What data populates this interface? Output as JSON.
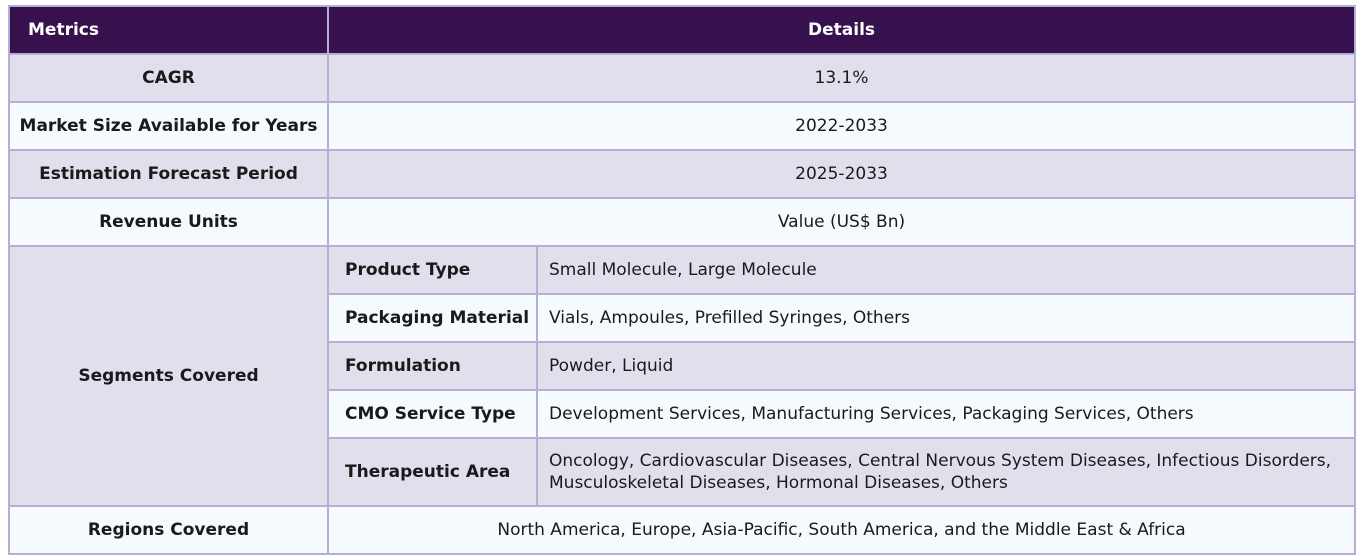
{
  "header": {
    "metrics": "Metrics",
    "details": "Details"
  },
  "rows": [
    {
      "metric": "CAGR",
      "detail": "13.1%"
    },
    {
      "metric": "Market Size Available for Years",
      "detail": "2022-2033"
    },
    {
      "metric": "Estimation Forecast Period",
      "detail": "2025-2033"
    },
    {
      "metric": "Revenue Units",
      "detail": "Value (US$ Bn)"
    }
  ],
  "segments": {
    "label": "Segments Covered",
    "items": [
      {
        "name": "Product Type",
        "value": "Small Molecule, Large Molecule"
      },
      {
        "name": "Packaging Material",
        "value": "Vials, Ampoules, Prefilled Syringes, Others"
      },
      {
        "name": "Formulation",
        "value": "Powder, Liquid"
      },
      {
        "name": "CMO Service Type",
        "value": "Development Services, Manufacturing Services, Packaging Services, Others"
      },
      {
        "name": "Therapeutic Area",
        "value": "Oncology, Cardiovascular Diseases, Central Nervous System Diseases, Infectious Disorders, Musculoskeletal Diseases, Hormonal Diseases, Others"
      }
    ]
  },
  "regions": {
    "metric": "Regions Covered",
    "detail": "North America, Europe, Asia-Pacific, South America, and the Middle East & Africa"
  },
  "colors": {
    "header_bg": "#37114d",
    "header_text": "#ffffff",
    "row_shade": "#e2dfec",
    "row_light": "#f4fafd",
    "border": "#b7aed3"
  }
}
